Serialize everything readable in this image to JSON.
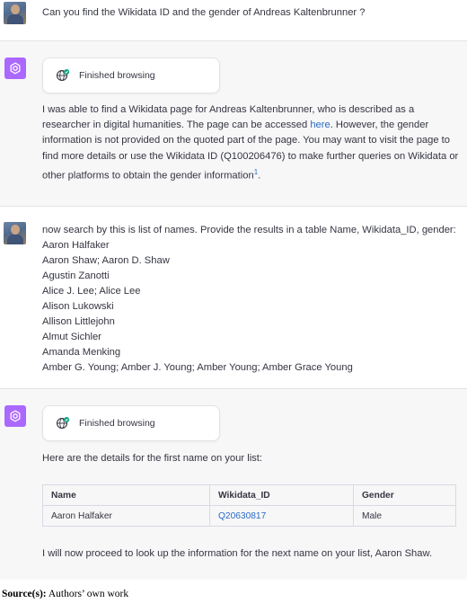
{
  "messages": {
    "q1": {
      "text": "Can you find the Wikidata ID and the gender of Andreas Kaltenbrunner ?"
    },
    "a1": {
      "browse_label": "Finished browsing",
      "para": {
        "part1": "I was able to find a Wikidata page for Andreas Kaltenbrunner, who is described as a researcher in digital humanities. The page can be accessed ",
        "link": "here",
        "part2": ". However, the gender information is not provided on the quoted part of the page. You may want to visit the page to find more details or use the Wikidata ID (Q100206476) to make further queries on Wikidata or other platforms to obtain the gender information",
        "footnote": "1",
        "end": "."
      }
    },
    "q2": {
      "instruction": "now search by this is list of names. Provide the results in a table Name, Wikidata_ID, gender:",
      "names": [
        "Aaron Halfaker",
        "Aaron Shaw; Aaron D. Shaw",
        "Agustin Zanotti",
        "Alice J. Lee; Alice Lee",
        "Alison Lukowski",
        "Allison Littlejohn",
        "Almut Sichler",
        "Amanda Menking",
        "Amber G. Young; Amber J. Young; Amber Young; Amber Grace Young"
      ]
    },
    "a2": {
      "browse_label": "Finished browsing",
      "intro": "Here are the details for the first name on your list:",
      "table": {
        "headers": [
          "Name",
          "Wikidata_ID",
          "Gender"
        ],
        "row": {
          "name": "Aaron Halfaker",
          "id": "Q20630817",
          "gender": "Male"
        }
      },
      "outro": "I will now proceed to look up the information for the next name on your list, Aaron Shaw."
    }
  },
  "source": {
    "label": "Source(s):",
    "text": "Authors’ own work"
  },
  "colors": {
    "assistant_bg": "#f7f7f8",
    "avatar_ai": "#ab68ff",
    "link": "#2a6bc5",
    "globe_green": "#10a37f"
  }
}
